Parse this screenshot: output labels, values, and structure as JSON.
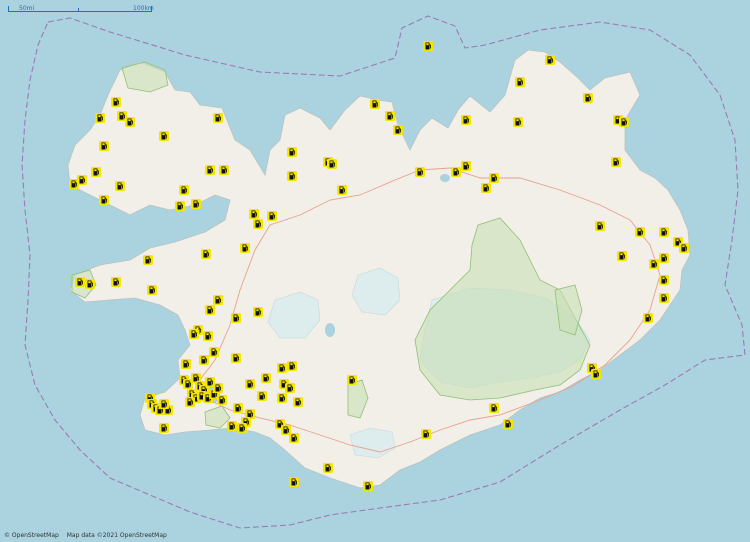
{
  "scale": {
    "left_label": "50mi",
    "right_label": "100km"
  },
  "attribution": {
    "osm": "© OpenStreetMap",
    "data": "Map data ©2021 OpenStreetMap"
  },
  "colors": {
    "water": "#aad3df",
    "land": "#f2efe9",
    "glacier": "#ddecec",
    "park_fill": "#c8dfb6",
    "park_stroke": "#8fbf76",
    "road": "#e8a08a",
    "boundary": "#9b7bb2",
    "marker_bg": "#f5e600",
    "marker_icon": "#111111"
  },
  "markers": {
    "icon": "fuel-station-icon",
    "count": 172
  }
}
